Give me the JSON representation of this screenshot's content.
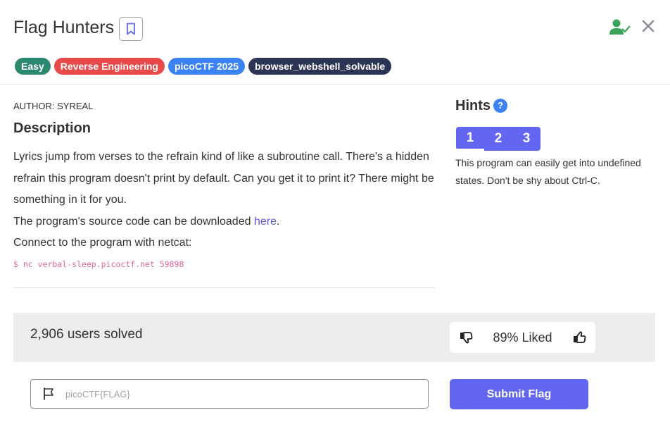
{
  "challenge": {
    "title": "Flag Hunters",
    "tags": [
      {
        "label": "Easy",
        "color": "#2b8a6e"
      },
      {
        "label": "Reverse Engineering",
        "color": "#e84a4a"
      },
      {
        "label": "picoCTF 2025",
        "color": "#3b82f6"
      },
      {
        "label": "browser_webshell_solvable",
        "color": "#2d3557"
      }
    ]
  },
  "description": {
    "author": "AUTHOR: SYREAL",
    "heading": "Description",
    "line1": "Lyrics jump from verses to the refrain kind of like a subroutine call. There's a hidden refrain this program doesn't print by default. Can you get it to print it? There might be something in it for you.",
    "line2_prefix": "The program's source code can be downloaded ",
    "line2_link": "here",
    "line2_suffix": ".",
    "line3": "Connect to the program with netcat:",
    "command": "$ nc verbal-sleep.picoctf.net 59898"
  },
  "hints": {
    "heading": "Hints",
    "help_glyph": "?",
    "tabs": [
      "1",
      "2",
      "3"
    ],
    "selected": 0,
    "text": "This program can easily get into undefined states. Don't be shy about Ctrl-C."
  },
  "stats": {
    "solved": "2,906 users solved",
    "liked": "89% Liked"
  },
  "flag_form": {
    "placeholder": "picoCTF{FLAG}",
    "submit_label": "Submit Flag"
  },
  "colors": {
    "accent": "#6366f1",
    "link": "#5b5bd6",
    "command": "#e0679a",
    "solved_check": "#3aa35a"
  }
}
